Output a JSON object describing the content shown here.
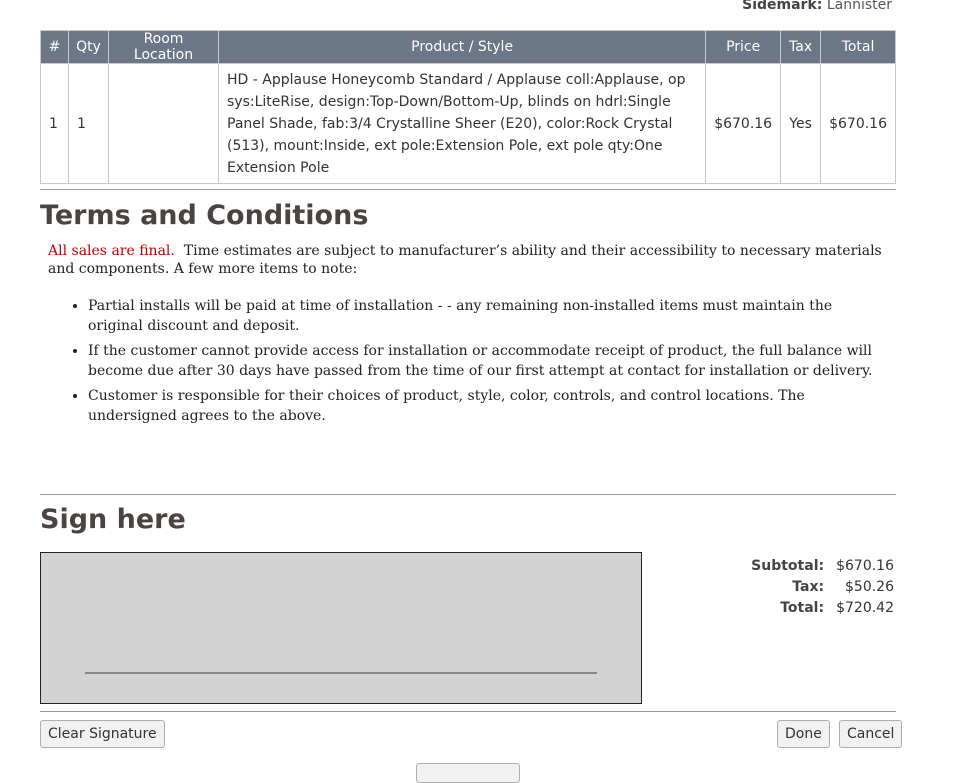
{
  "sidemark": {
    "label": "Sidemark:",
    "value": "Lannister"
  },
  "table": {
    "headers": [
      "#",
      "Qty",
      "Room Location",
      "Product / Style",
      "Price",
      "Tax",
      "Total"
    ],
    "rows": [
      {
        "num": "1",
        "qty": "1",
        "room": "",
        "product": "HD - Applause Honeycomb Standard / Applause coll:Applause, op sys:LiteRise, design:Top-Down/Bottom-Up, blinds on hdrl:Single Panel Shade, fab:3/4 Crystalline Sheer (E20), color:Rock Crystal (513), mount:Inside, ext pole:Extension Pole, ext pole qty:One Extension Pole",
        "price": "$670.16",
        "tax": "Yes",
        "total": "$670.16"
      }
    ]
  },
  "terms": {
    "heading": "Terms and Conditions",
    "final": "All sales are final.",
    "intro": "Time estimates are subject to manufacturer’s ability and their accessibility to necessary materials and components.  A few more items to note:",
    "items": [
      "Partial installs will be paid at time of installation - - any remaining non-installed items must maintain the original discount and deposit.",
      "If the customer cannot provide access for installation or accommodate receipt of product, the full balance will become due after 30 days have passed from the time of our first attempt at contact for installation or delivery.",
      "Customer is responsible for their choices of product, style, color, controls, and control locations.  The undersigned agrees to the above."
    ]
  },
  "sign": {
    "heading": "Sign here"
  },
  "totals": {
    "subtotal_label": "Subtotal:",
    "subtotal": "$670.16",
    "tax_label": "Tax:",
    "tax": "$50.26",
    "total_label": "Total:",
    "total": "$720.42"
  },
  "buttons": {
    "clear": "Clear Signature",
    "done": "Done",
    "cancel": "Cancel"
  }
}
